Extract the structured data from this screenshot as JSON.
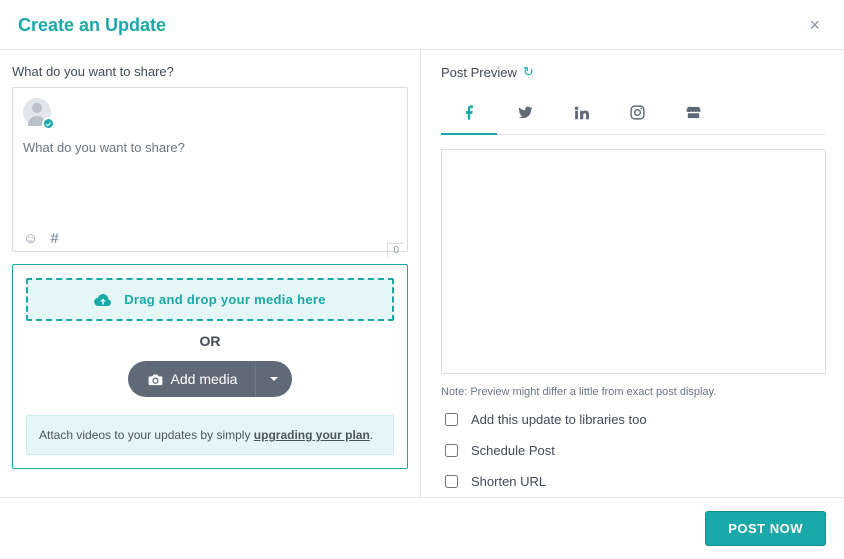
{
  "header": {
    "title": "Create an Update"
  },
  "composer": {
    "prompt": "What do you want to share?",
    "placeholder": "What do you want to share?",
    "char_count": "0"
  },
  "media": {
    "drop_text": "Drag and drop your media here",
    "or_label": "OR",
    "add_media_label": "Add media",
    "upgrade_prefix": "Attach videos to your updates by simply ",
    "upgrade_link": "upgrading your plan",
    "upgrade_suffix": "."
  },
  "preview": {
    "label": "Post Preview",
    "note": "Note: Preview might differ a little from exact post display.",
    "tabs": [
      {
        "name": "facebook",
        "active": true
      },
      {
        "name": "twitter",
        "active": false
      },
      {
        "name": "linkedin",
        "active": false
      },
      {
        "name": "instagram",
        "active": false
      },
      {
        "name": "gmb",
        "active": false
      }
    ]
  },
  "options": {
    "add_to_libraries": "Add this update to libraries too",
    "schedule_post": "Schedule Post",
    "shorten_url": "Shorten URL"
  },
  "footer": {
    "post_now": "POST NOW"
  }
}
